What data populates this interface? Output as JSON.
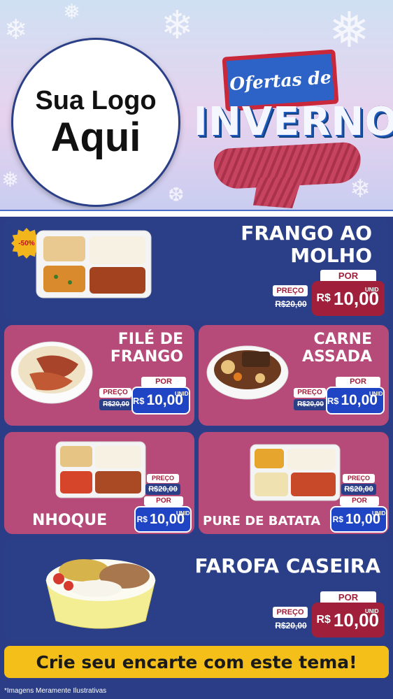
{
  "logo": {
    "line1": "Sua Logo",
    "line2": "Aqui"
  },
  "theme": {
    "sign": "Ofertas de",
    "word": "INVERNO"
  },
  "offers": [
    {
      "name": "FRANGO AO MOLHO",
      "line1": "FRANGO AO",
      "line2": "MOLHO",
      "badge": "-50%",
      "preco_label": "PREÇO",
      "old_price": "R$20,00",
      "por_label": "POR",
      "currency": "R$",
      "price": "10,00",
      "unit": "UNID"
    },
    {
      "name": "FILÉ DE FRANGO",
      "line1": "FILÉ DE",
      "line2": "FRANGO",
      "preco_label": "PREÇO",
      "old_price": "R$20,00",
      "por_label": "POR",
      "currency": "R$",
      "price": "10,00",
      "unit": "UNID"
    },
    {
      "name": "CARNE ASSADA",
      "line1": "CARNE",
      "line2": "ASSADA",
      "preco_label": "PREÇO",
      "old_price": "R$20,00",
      "por_label": "POR",
      "currency": "R$",
      "price": "10,00",
      "unit": "UNID"
    },
    {
      "name": "NHOQUE",
      "preco_label": "PREÇO",
      "old_price": "R$20,00",
      "por_label": "POR",
      "currency": "R$",
      "price": "10,00",
      "unit": "UNID"
    },
    {
      "name": "PURE DE BATATA",
      "preco_label": "PREÇO",
      "old_price": "R$20,00",
      "por_label": "POR",
      "currency": "R$",
      "price": "10,00",
      "unit": "UNID"
    },
    {
      "name": "FAROFA CASEIRA",
      "preco_label": "PREÇO",
      "old_price": "R$20,00",
      "por_label": "POR",
      "currency": "R$",
      "price": "10,00",
      "unit": "UNID"
    }
  ],
  "footer": {
    "cta": "Crie seu encarte com este tema!",
    "note": "*Imagens Meramente Ilustrativas"
  },
  "colors": {
    "blue_card": "#2b3f88",
    "pink_card": "#b64a78",
    "price_red": "#a01f3a",
    "price_blue": "#1f44c4",
    "footer_yellow": "#f3bf18"
  },
  "icons": [
    "snowflake-icon"
  ]
}
